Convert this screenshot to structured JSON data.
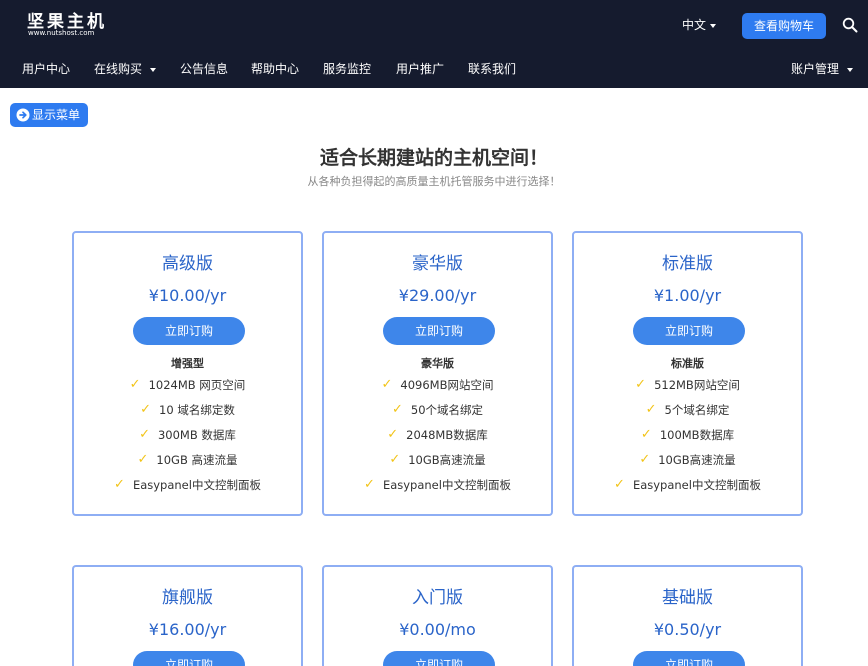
{
  "header": {
    "logo_title": "坚果主机",
    "logo_sub": "www.nutshost.com",
    "lang": "中文",
    "cart": "查看购物车"
  },
  "nav": {
    "items": [
      "用户中心",
      "在线购买",
      "公告信息",
      "帮助中心",
      "服务监控",
      "用户推广",
      "联系我们"
    ],
    "account": "账户管理"
  },
  "menu_btn": "显示菜单",
  "hero": {
    "title": "适合长期建站的主机空间！",
    "subtitle": "从各种负担得起的高质量主机托管服务中进行选择！"
  },
  "order_label": "立即订购",
  "plans": [
    {
      "name": "高级版",
      "price": "¥10.00/yr",
      "sub": "增强型",
      "features": [
        "1024MB 网页空间",
        "10 域名绑定数",
        "300MB 数据库",
        "10GB 高速流量",
        "Easypanel中文控制面板"
      ]
    },
    {
      "name": "豪华版",
      "price": "¥29.00/yr",
      "sub": "豪华版",
      "features": [
        "4096MB网站空间",
        "50个域名绑定",
        "2048MB数据库",
        "10GB高速流量",
        "Easypanel中文控制面板"
      ]
    },
    {
      "name": "标准版",
      "price": "¥1.00/yr",
      "sub": "标准版",
      "features": [
        "512MB网站空间",
        "5个域名绑定",
        "100MB数据库",
        "10GB高速流量",
        "Easypanel中文控制面板"
      ]
    },
    {
      "name": "旗舰版",
      "price": "¥16.00/yr"
    },
    {
      "name": "入门版",
      "price": "¥0.00/mo"
    },
    {
      "name": "基础版",
      "price": "¥0.50/yr"
    }
  ],
  "colors": {
    "header_bg": "#151b2e",
    "accent": "#2e7bf0",
    "card_border": "#8eaef4",
    "plan_text": "#2a64c9",
    "check": "#f2c419"
  }
}
